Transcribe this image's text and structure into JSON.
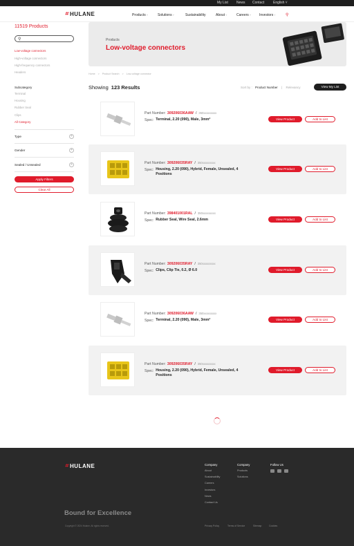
{
  "topbar": {
    "links": [
      "My List",
      "News",
      "Contact"
    ],
    "language": "English"
  },
  "nav": {
    "logo_text": "HULANE",
    "items": [
      {
        "label": "Products",
        "has_dropdown": true
      },
      {
        "label": "Solutions",
        "has_dropdown": true
      },
      {
        "label": "Sustainability",
        "has_dropdown": false
      },
      {
        "label": "About",
        "has_dropdown": true
      },
      {
        "label": "Careers",
        "has_dropdown": true
      },
      {
        "label": "Investors",
        "has_dropdown": true
      }
    ]
  },
  "sidebar": {
    "count_title": "11519 Products",
    "categories": [
      {
        "label": "Low-voltage connectors",
        "active": true
      },
      {
        "label": "High-voltage connectors",
        "active": false
      },
      {
        "label": "High-frequency connectors",
        "active": false
      },
      {
        "label": "Headers",
        "active": false
      }
    ],
    "subcategory_title": "Subcategory",
    "subcategories": [
      {
        "label": "Terminal",
        "active": false
      },
      {
        "label": "Housing",
        "active": false
      },
      {
        "label": "Rubber Seal",
        "active": false
      },
      {
        "label": "Clips",
        "active": false
      },
      {
        "label": "All Category",
        "active": true
      }
    ],
    "filters": [
      "Type",
      "Gender",
      "Sealed / Unsealed"
    ],
    "apply_label": "Apply Filters",
    "clear_label": "Clear All"
  },
  "banner": {
    "crumb": "Products",
    "title": "Low-voltage connectors"
  },
  "breadcrumb": [
    "Home",
    ">",
    "Product Search",
    ">",
    "Low-voltage connector"
  ],
  "results": {
    "showing_label": "Showing",
    "count_label": "123 Results",
    "sort_label": "Sort by :",
    "sort_options": [
      "Product Number",
      "Relevancy"
    ],
    "view_list_label": "View My List"
  },
  "products": [
    {
      "part_label": "Part Number:",
      "part_number": "309206036AAW",
      "alt_number": "350xxxxxxxxx",
      "spec_label": "Spec:",
      "spec": "Terminal, 2.20 (090), Male, 3mm²",
      "image": "terminal-icon"
    },
    {
      "part_label": "Part Number:",
      "part_number": "309206035RAY",
      "alt_number": "350xxxxxxxxx",
      "spec_label": "Spec:",
      "spec": "Housing, 2.20 (090), Hybrid, Female, Unsealed, 4 Positions",
      "image": "housing-icon"
    },
    {
      "part_label": "Part Number:",
      "part_number": "398401001RAL",
      "alt_number": "350xxxxxxxxx",
      "spec_label": "Spec:",
      "spec": "Rubber Seal, Wire Seal, 2.6mm",
      "image": "rubber-seal-icon"
    },
    {
      "part_label": "Part Number:",
      "part_number": "309206035RAY",
      "alt_number": "350xxxxxxxxx",
      "spec_label": "Spec:",
      "spec": "Clips, Clip Tie, 0.2, Ø 6.0",
      "image": "clip-icon"
    },
    {
      "part_label": "Part Number:",
      "part_number": "309206036AAW",
      "alt_number": "350xxxxxxxxx",
      "spec_label": "Spec:",
      "spec": "Terminal, 2.20 (090), Male, 3mm²",
      "image": "terminal-icon"
    },
    {
      "part_label": "Part Number:",
      "part_number": "309206035RAY",
      "alt_number": "350xxxxxxxxx",
      "spec_label": "Spec:",
      "spec": "Housing, 2.20 (090), Hybrid, Female, Unsealed, 4 Positions",
      "image": "housing-icon"
    }
  ],
  "product_buttons": {
    "view": "View Product",
    "add": "Add to List"
  },
  "footer": {
    "logo_text": "HULANE",
    "tagline": "Bound for Excellence",
    "copyright": "Copyright © 2024 Hulane. All rights reserved.",
    "col1": {
      "title": "Company",
      "links": [
        "About",
        "Sustainability",
        "Careers",
        "Investors",
        "News",
        "Contact Us"
      ]
    },
    "col2": {
      "title": "Company",
      "links": [
        "Products",
        "Solutions"
      ]
    },
    "col3": {
      "title": "Follow Us",
      "icons": [
        "linkedin-icon",
        "wechat-icon",
        "youtube-icon"
      ]
    },
    "legal": [
      "Privacy Policy",
      "Terms of Service",
      "Sitemap",
      "Cookies"
    ]
  },
  "colors": {
    "accent": "#e01b2b",
    "dark": "#1e1e1e",
    "footer": "#2a2a2a",
    "row_alt": "#f2f2f2"
  }
}
